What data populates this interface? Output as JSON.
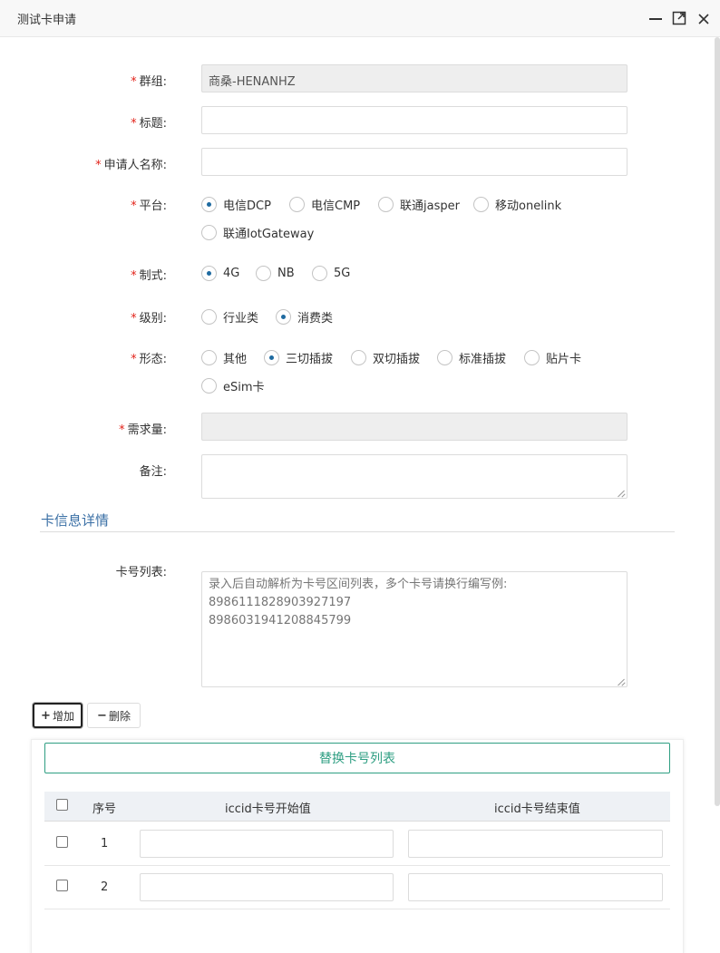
{
  "window": {
    "title": "测试卡申请"
  },
  "form": {
    "group": {
      "label": "群组:",
      "value": "商桑-HENANHZ"
    },
    "title_field": {
      "label": "标题:",
      "value": ""
    },
    "applicant": {
      "label": "申请人名称:",
      "value": ""
    },
    "platform": {
      "label": "平台:",
      "options": [
        "电信DCP",
        "电信CMP",
        "联通jasper",
        "移动onelink",
        "联通IotGateway"
      ],
      "selected": "电信DCP"
    },
    "standard": {
      "label": "制式:",
      "options": [
        "4G",
        "NB",
        "5G"
      ],
      "selected": "4G"
    },
    "level": {
      "label": "级别:",
      "options": [
        "行业类",
        "消费类"
      ],
      "selected": "消费类"
    },
    "form_factor": {
      "label": "形态:",
      "options": [
        "其他",
        "三切插拔",
        "双切插拔",
        "标准插拔",
        "贴片卡",
        "eSim卡"
      ],
      "selected": "三切插拔"
    },
    "quantity": {
      "label": "需求量:",
      "value": ""
    },
    "remark": {
      "label": "备注:",
      "value": ""
    }
  },
  "card_section": {
    "title": "卡信息详情",
    "card_list_label": "卡号列表:",
    "card_list_placeholder": "录入后自动解析为卡号区间列表，多个卡号请换行编写例:\n8986111828903927197\n8986031941208845799",
    "add_label": "增加",
    "delete_label": "删除",
    "replace_label": "替换卡号列表",
    "table": {
      "headers": {
        "index": "序号",
        "start": "iccid卡号开始值",
        "end": "iccid卡号结束值"
      },
      "rows": [
        {
          "index": "1",
          "start": "",
          "end": ""
        },
        {
          "index": "2",
          "start": "",
          "end": ""
        }
      ]
    }
  }
}
